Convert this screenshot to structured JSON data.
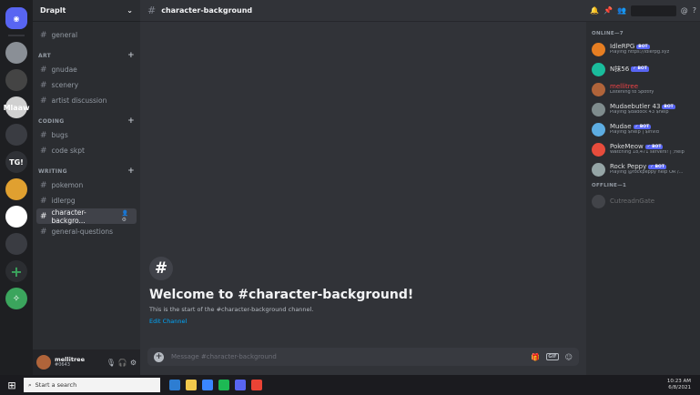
{
  "guild": {
    "name": "Draplt"
  },
  "servers": [
    {
      "label": ""
    },
    {
      "label": ""
    },
    {
      "label": "Mlaaw"
    },
    {
      "label": ""
    },
    {
      "label": "TG!"
    },
    {
      "label": ""
    },
    {
      "label": ""
    },
    {
      "label": ""
    }
  ],
  "channels_top": [
    {
      "name": "general"
    }
  ],
  "categories": [
    {
      "name": "ART",
      "channels": [
        {
          "name": "gnudae"
        },
        {
          "name": "scenery"
        },
        {
          "name": "artist discussion"
        }
      ]
    },
    {
      "name": "CODING",
      "channels": [
        {
          "name": "bugs"
        },
        {
          "name": "code skpt"
        }
      ]
    },
    {
      "name": "WRITING",
      "channels": [
        {
          "name": "pokemon"
        },
        {
          "name": "idlerpg"
        },
        {
          "name": "character-backgro...",
          "active": true
        },
        {
          "name": "general-questions"
        }
      ]
    }
  ],
  "user": {
    "name": "mellitree",
    "tag": "#0643"
  },
  "header": {
    "channel": "character-background"
  },
  "welcome": {
    "icon": "#",
    "title": "Welcome to #character-background!",
    "subtitle": "This is the start of the #character-background channel.",
    "link": "Edit Channel"
  },
  "composer": {
    "placeholder": "Message #character-background"
  },
  "members": {
    "groups": [
      {
        "name": "ONLINE—7",
        "items": [
          {
            "name": "IdleRPG",
            "bot": "BOT",
            "status": "Playing https://idlerpg.xyz",
            "color": "#e67e22"
          },
          {
            "name": "N抹56",
            "bot": "✓ BOT",
            "status": "",
            "color": "#1abc9c"
          },
          {
            "name": "mellitree",
            "bot": "",
            "status": "Listening to Spotify",
            "color": "#b0643a",
            "red": true
          },
          {
            "name": "Mudaebutler 43",
            "bot": "BOT",
            "status": "Playing $dadock 43 $help",
            "color": "#7f8c8d"
          },
          {
            "name": "Mudae",
            "bot": "✓ BOT",
            "status": "Playing $help | $invid",
            "color": "#5dade2"
          },
          {
            "name": "PokeMeow",
            "bot": "✓ BOT",
            "status": "Watching 18,471 servers! | ;help",
            "color": "#e74c3c"
          },
          {
            "name": "Rock Peppy",
            "bot": "✓ BOT",
            "status": "Playing @rockpeppy help OR /...",
            "color": "#95a5a6"
          }
        ]
      },
      {
        "name": "OFFLINE—1",
        "items": [
          {
            "name": "CutreadnGate",
            "bot": "",
            "status": "",
            "color": "#6d6f78",
            "offline": true
          }
        ]
      }
    ]
  },
  "taskbar": {
    "search_placeholder": "Start a search",
    "time": "10:23 AM",
    "date": "6/8/2021"
  }
}
